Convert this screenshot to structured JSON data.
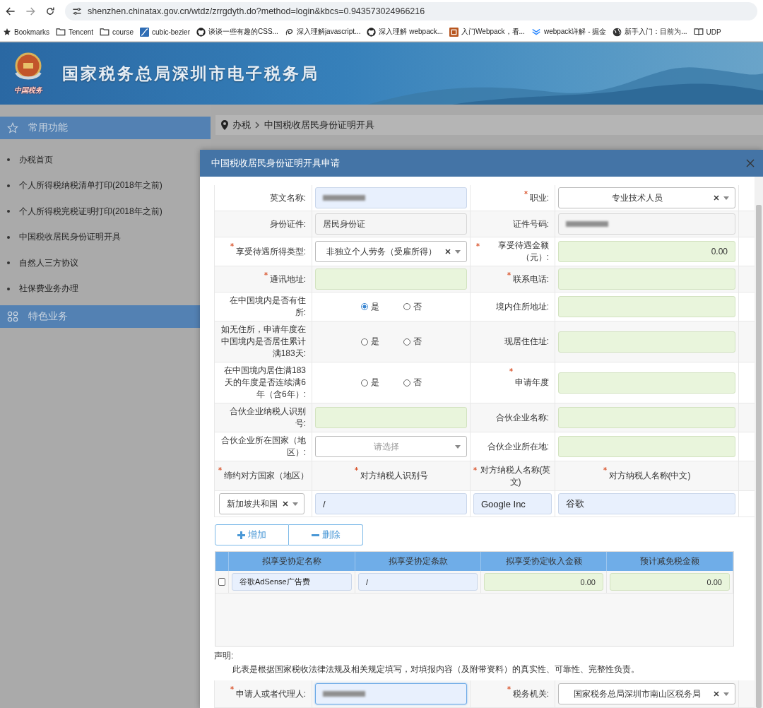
{
  "browser": {
    "url": "shenzhen.chinatax.gov.cn/wtdz/zrrgdyth.do?method=login&kbcs=0.943573024966216",
    "bookmarks": [
      {
        "label": "Bookmarks",
        "kind": "star"
      },
      {
        "label": "Tencent",
        "kind": "folder"
      },
      {
        "label": "course",
        "kind": "folder"
      },
      {
        "label": "cubic-bezier",
        "kind": "curve"
      },
      {
        "label": "谈谈一些有趣的CSS...",
        "kind": "github"
      },
      {
        "label": "深入理解javascript...",
        "kind": "swirl"
      },
      {
        "label": "深入理解 webpack...",
        "kind": "github"
      },
      {
        "label": "入门Webpack，看...",
        "kind": "tile"
      },
      {
        "label": "webpack详解 - 掘金",
        "kind": "chevrons"
      },
      {
        "label": "新手入门：目前为...",
        "kind": "globe"
      },
      {
        "label": "UDP",
        "kind": "book"
      }
    ]
  },
  "banner": {
    "caption": "中国税务",
    "title": "国家税务总局深圳市电子税务局"
  },
  "sidebar": {
    "sections": [
      {
        "title": "常用功能",
        "kind": "star",
        "items": [
          "办税首页",
          "个人所得税纳税清单打印(2018年之前)",
          "个人所得税完税证明打印(2018年之前)",
          "中国税收居民身份证明开具",
          "自然人三方协议",
          "社保费业务办理"
        ]
      },
      {
        "title": "特色业务",
        "kind": "grid"
      }
    ]
  },
  "breadcrumb": [
    "办税",
    "中国税收居民身份证明开具"
  ],
  "dialog": {
    "title": "中国税收居民身份证明开具申请",
    "form_rows": [
      {
        "fields": [
          {
            "label": "英文名称:",
            "required": false,
            "control": {
              "kind": "redacted",
              "readonly": false,
              "highlighted": false
            }
          },
          {
            "label": "职业:",
            "required": true,
            "control": {
              "kind": "select",
              "value": "专业技术人员",
              "clearable": true
            }
          }
        ]
      },
      {
        "fields": [
          {
            "label": "身份证件:",
            "required": false,
            "control": {
              "kind": "text",
              "value": "居民身份证",
              "readonly": true,
              "highlighted": false
            }
          },
          {
            "label": "证件号码:",
            "required": false,
            "control": {
              "kind": "redacted",
              "readonly": true,
              "highlighted": false
            }
          }
        ]
      },
      {
        "fields": [
          {
            "label": "享受待遇所得类型:",
            "required": true,
            "control": {
              "kind": "select",
              "value": "非独立个人劳务（受雇所得）",
              "clearable": true
            }
          },
          {
            "label": "享受待遇金额（元）:",
            "required": true,
            "control": {
              "kind": "amount",
              "value": "0.00",
              "readonly": false,
              "highlighted": true
            }
          }
        ]
      },
      {
        "fields": [
          {
            "label": "通讯地址:",
            "required": true,
            "control": {
              "kind": "text",
              "readonly": false,
              "highlighted": true
            }
          },
          {
            "label": "联系电话:",
            "required": true,
            "control": {
              "kind": "text",
              "readonly": false,
              "highlighted": true
            }
          }
        ]
      },
      {
        "fields": [
          {
            "label": "在中国境内是否有住所:",
            "required": false,
            "control": {
              "kind": "radio",
              "options": [
                {
                  "label": "是",
                  "selected": true
                },
                {
                  "label": "否",
                  "selected": false
                }
              ]
            }
          },
          {
            "label": "境内住所地址:",
            "required": false,
            "control": {
              "kind": "text",
              "readonly": false,
              "highlighted": true
            }
          }
        ]
      },
      {
        "fields": [
          {
            "label": "如无住所，申请年度在中国境内是否居住累计满183天:",
            "required": false,
            "control": {
              "kind": "radio",
              "options": [
                {
                  "label": "是",
                  "selected": false
                },
                {
                  "label": "否",
                  "selected": false
                }
              ]
            }
          },
          {
            "label": "现居住住址:",
            "required": false,
            "control": {
              "kind": "text",
              "readonly": false,
              "highlighted": true
            }
          }
        ]
      },
      {
        "fields": [
          {
            "label": "在中国境内居住满183天的年度是否连续满6年（含6年）:",
            "required": false,
            "control": {
              "kind": "radio",
              "options": [
                {
                  "label": "是",
                  "selected": false
                },
                {
                  "label": "否",
                  "selected": false
                }
              ]
            }
          },
          {
            "label": "申请年度",
            "required": true,
            "control": {
              "kind": "text",
              "readonly": false,
              "highlighted": true
            }
          }
        ]
      },
      {
        "fields": [
          {
            "label": "合伙企业纳税人识别号:",
            "required": false,
            "control": {
              "kind": "text",
              "readonly": false,
              "highlighted": true
            }
          },
          {
            "label": "合伙企业名称:",
            "required": false,
            "control": {
              "kind": "text",
              "readonly": false,
              "highlighted": true
            }
          }
        ]
      },
      {
        "fields": [
          {
            "label": "合伙企业所在国家（地区）:",
            "required": false,
            "control": {
              "kind": "select",
              "placeholder": "请选择",
              "clearable": false
            }
          },
          {
            "label": "合伙企业所在地:",
            "required": false,
            "control": {
              "kind": "text",
              "readonly": false,
              "highlighted": true
            }
          }
        ]
      }
    ],
    "counterparty": {
      "columns": [
        {
          "label": "缔约对方国家（地区）",
          "required": true
        },
        {
          "label": "对方纳税人识别号",
          "required": true
        },
        {
          "label": "对方纳税人名称(英文)",
          "required": true
        },
        {
          "label": "对方纳税人名称(中文)",
          "required": true
        }
      ],
      "cells": [
        {
          "kind": "select",
          "value": "新加坡共和国",
          "clearable": true
        },
        {
          "kind": "text",
          "value": "/",
          "readonly": false,
          "highlighted": false
        },
        {
          "kind": "text",
          "value": "Google Inc",
          "readonly": false,
          "highlighted": false
        },
        {
          "kind": "text",
          "value": "谷歌",
          "readonly": false,
          "highlighted": false
        }
      ]
    },
    "actions": [
      {
        "label": "增加",
        "kind": "plus"
      },
      {
        "label": "删除",
        "kind": "minus"
      }
    ],
    "agreements": {
      "columns": [
        "拟享受协定名称",
        "拟享受协定条款",
        "拟享受协定收入金额",
        "预计减免税金额"
      ],
      "rows": [
        {
          "checked": false,
          "cells": [
            {
              "kind": "text",
              "value": "谷歌AdSense广告费",
              "readonly": false,
              "highlighted": false
            },
            {
              "kind": "text",
              "value": "/",
              "readonly": false,
              "highlighted": false
            },
            {
              "kind": "amount",
              "value": "0.00",
              "readonly": false,
              "highlighted": true
            },
            {
              "kind": "amount",
              "value": "0.00",
              "readonly": false,
              "highlighted": true
            }
          ]
        }
      ]
    },
    "declaration": {
      "title": "声明:",
      "text": "此表是根据国家税收法律法规及相关规定填写，对填报内容（及附带资料）的真实性、可靠性、完整性负责。"
    },
    "signature_row": {
      "fields": [
        {
          "label": "申请人或者代理人:",
          "required": true,
          "control": {
            "kind": "redacted",
            "readonly": false,
            "highlighted": false,
            "focused": true
          }
        },
        {
          "label": "税务机关:",
          "required": true,
          "control": {
            "kind": "select",
            "value": "国家税务总局深圳市南山区税务局",
            "clearable": true
          }
        }
      ]
    }
  }
}
